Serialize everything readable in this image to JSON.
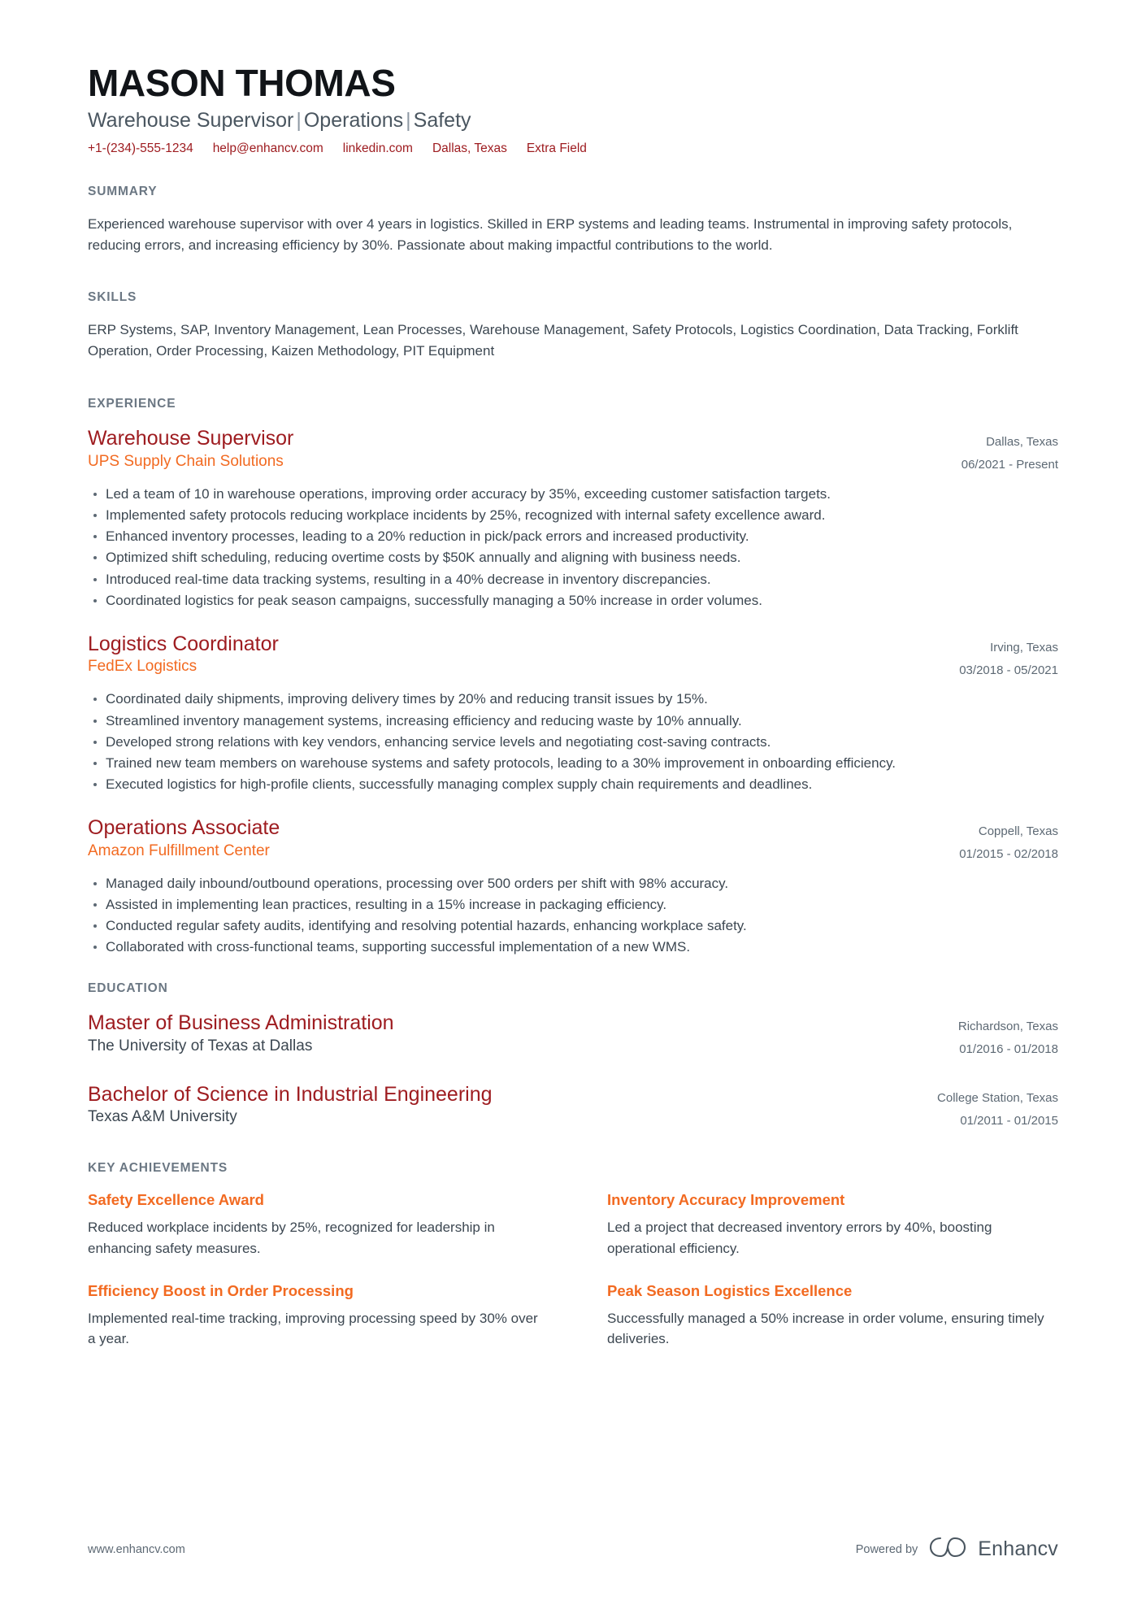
{
  "header": {
    "name": "MASON THOMAS",
    "headline_parts": [
      "Warehouse Supervisor",
      "Operations",
      "Safety"
    ],
    "separator": "|",
    "contacts": [
      {
        "name": "phone",
        "value": "+1-(234)-555-1234"
      },
      {
        "name": "email",
        "value": "help@enhancv.com"
      },
      {
        "name": "linkedin",
        "value": "linkedin.com"
      },
      {
        "name": "location",
        "value": "Dallas, Texas"
      },
      {
        "name": "extra",
        "value": "Extra Field"
      }
    ]
  },
  "summary": {
    "title": "SUMMARY",
    "text": "Experienced warehouse supervisor with over 4 years in logistics. Skilled in ERP systems and leading teams. Instrumental in improving safety protocols, reducing errors, and increasing efficiency by 30%. Passionate about making impactful contributions to the world."
  },
  "skills": {
    "title": "SKILLS",
    "text": "ERP Systems, SAP, Inventory Management, Lean Processes, Warehouse Management, Safety Protocols, Logistics Coordination, Data Tracking, Forklift Operation, Order Processing, Kaizen Methodology, PIT Equipment"
  },
  "experience": {
    "title": "EXPERIENCE",
    "entries": [
      {
        "role": "Warehouse Supervisor",
        "company": "UPS Supply Chain Solutions",
        "location": "Dallas, Texas",
        "dates": "06/2021 - Present",
        "bullets": [
          "Led a team of 10 in warehouse operations, improving order accuracy by 35%, exceeding customer satisfaction targets.",
          "Implemented safety protocols reducing workplace incidents by 25%, recognized with internal safety excellence award.",
          "Enhanced inventory processes, leading to a 20% reduction in pick/pack errors and increased productivity.",
          "Optimized shift scheduling, reducing overtime costs by $50K annually and aligning with business needs.",
          "Introduced real-time data tracking systems, resulting in a 40% decrease in inventory discrepancies.",
          "Coordinated logistics for peak season campaigns, successfully managing a 50% increase in order volumes."
        ]
      },
      {
        "role": "Logistics Coordinator",
        "company": "FedEx Logistics",
        "location": "Irving, Texas",
        "dates": "03/2018 - 05/2021",
        "bullets": [
          "Coordinated daily shipments, improving delivery times by 20% and reducing transit issues by 15%.",
          "Streamlined inventory management systems, increasing efficiency and reducing waste by 10% annually.",
          "Developed strong relations with key vendors, enhancing service levels and negotiating cost-saving contracts.",
          "Trained new team members on warehouse systems and safety protocols, leading to a 30% improvement in onboarding efficiency.",
          "Executed logistics for high-profile clients, successfully managing complex supply chain requirements and deadlines."
        ]
      },
      {
        "role": "Operations Associate",
        "company": "Amazon Fulfillment Center",
        "location": "Coppell, Texas",
        "dates": "01/2015 - 02/2018",
        "bullets": [
          "Managed daily inbound/outbound operations, processing over 500 orders per shift with 98% accuracy.",
          "Assisted in implementing lean practices, resulting in a 15% increase in packaging efficiency.",
          "Conducted regular safety audits, identifying and resolving potential hazards, enhancing workplace safety.",
          "Collaborated with cross-functional teams, supporting successful implementation of a new WMS."
        ]
      }
    ]
  },
  "education": {
    "title": "EDUCATION",
    "entries": [
      {
        "degree": "Master of Business Administration",
        "school": "The University of Texas at Dallas",
        "location": "Richardson, Texas",
        "dates": "01/2016 - 01/2018"
      },
      {
        "degree": "Bachelor of Science in Industrial Engineering",
        "school": "Texas A&M University",
        "location": "College Station, Texas",
        "dates": "01/2011 - 01/2015"
      }
    ]
  },
  "achievements": {
    "title": "KEY ACHIEVEMENTS",
    "items": [
      {
        "title": "Safety Excellence Award",
        "description": "Reduced workplace incidents by 25%, recognized for leadership in enhancing safety measures."
      },
      {
        "title": "Inventory Accuracy Improvement",
        "description": "Led a project that decreased inventory errors by 40%, boosting operational efficiency."
      },
      {
        "title": "Efficiency Boost in Order Processing",
        "description": "Implemented real-time tracking, improving processing speed by 30% over a year."
      },
      {
        "title": "Peak Season Logistics Excellence",
        "description": "Successfully managed a 50% increase in order volume, ensuring timely deliveries."
      }
    ]
  },
  "footer": {
    "url": "www.enhancv.com",
    "powered_by": "Powered by",
    "brand": "Enhancv"
  },
  "colors": {
    "accent_red": "#9e1c20",
    "accent_orange": "#f26a21",
    "heading_gray": "#6b7783",
    "body_gray": "#3c4751",
    "name_black": "#111418"
  }
}
